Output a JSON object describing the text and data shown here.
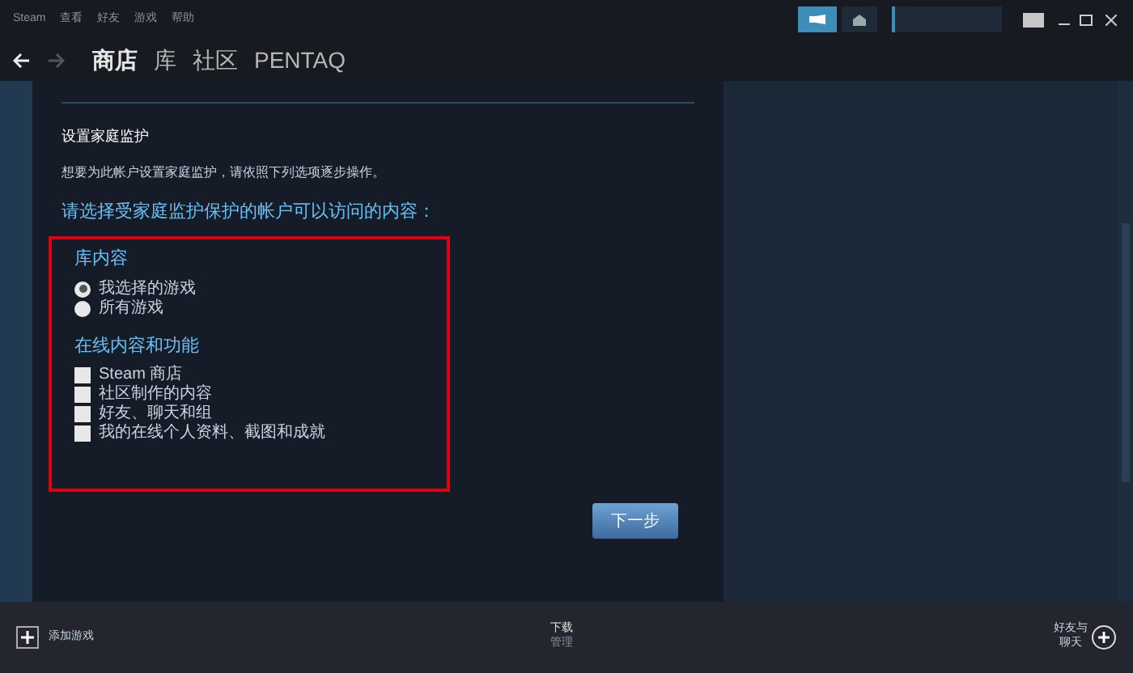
{
  "menu": [
    "Steam",
    "查看",
    "好友",
    "游戏",
    "帮助"
  ],
  "nav": [
    {
      "label": "商店",
      "selected": true
    },
    {
      "label": "库",
      "selected": false
    },
    {
      "label": "社区",
      "selected": false
    },
    {
      "label": "PENTAQ",
      "selected": false
    }
  ],
  "page": {
    "title": "设置家庭监护",
    "description": "想要为此帐户设置家庭监护，请依照下列选项逐步操作。",
    "prompt": "请选择受家庭监护保护的帐户可以访问的内容："
  },
  "sections": [
    {
      "heading": "库内容",
      "options": [
        {
          "kind": "radio",
          "label": "我选择的游戏",
          "selected": true
        },
        {
          "kind": "radio",
          "label": "所有游戏",
          "selected": false
        }
      ]
    },
    {
      "heading": "在线内容和功能",
      "options": [
        {
          "kind": "checkbox",
          "label": "Steam 商店",
          "checked": false
        },
        {
          "kind": "checkbox",
          "label": "社区制作的内容",
          "checked": false
        },
        {
          "kind": "checkbox",
          "label": "好友、聊天和组",
          "checked": false
        },
        {
          "kind": "checkbox",
          "label": "我的在线个人资料、截图和成就",
          "checked": false
        }
      ]
    }
  ],
  "next_button": "下一步",
  "bottom_bar": {
    "add_game": "添加游戏",
    "downloads": "下载",
    "downloads_sub": "管理",
    "friends": "好友与",
    "friends_sub": "聊天"
  }
}
